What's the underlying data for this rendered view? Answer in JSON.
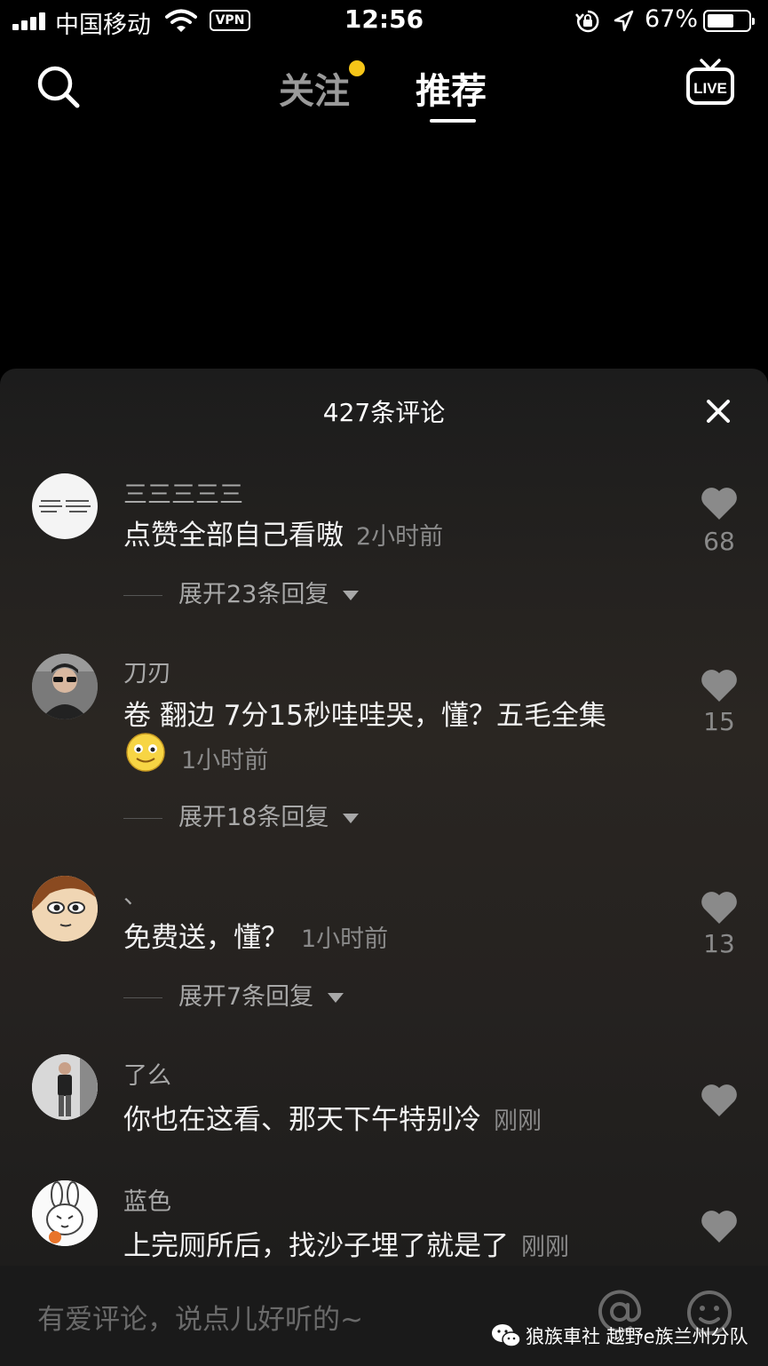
{
  "status_bar": {
    "carrier": "中国移动",
    "vpn": "VPN",
    "time": "12:56",
    "battery_pct": "67%",
    "battery_level": 0.67
  },
  "nav": {
    "tabs": [
      {
        "label": "关注",
        "active": false,
        "badge": true
      },
      {
        "label": "推荐",
        "active": true
      }
    ],
    "live_label": "LIVE",
    "icons": [
      "search-icon",
      "live-tv-icon"
    ]
  },
  "comments_panel": {
    "title": "427条评论",
    "comments": [
      {
        "username": "三三三三三",
        "text": "点赞全部自己看嗷",
        "time": "2小时前",
        "likes": "68",
        "replies": "展开23条回复"
      },
      {
        "username": "刀刃",
        "text": "卷 翻边 7分15秒哇哇哭，懂？五毛全集",
        "emoji": "smile-emoji",
        "time": "1小时前",
        "likes": "15",
        "replies": "展开18条回复"
      },
      {
        "username": "、",
        "text": "免费送，懂？",
        "time": "1小时前",
        "likes": "13",
        "replies": "展开7条回复"
      },
      {
        "username": "了么",
        "text": "你也在这看、那天下午特别冷",
        "time": "刚刚"
      },
      {
        "username": "蓝色",
        "text": "上完厕所后，找沙子埋了就是了",
        "time": "刚刚"
      }
    ]
  },
  "input_bar": {
    "placeholder": "有爱评论，说点儿好听的~",
    "icons": [
      "at-icon",
      "emoji-icon"
    ]
  },
  "watermark": {
    "text": "狼族車社 越野e族兰州分队"
  },
  "colors": {
    "accent_dot": "#f5c518",
    "background": "#000000",
    "sheet": "#2a2622"
  }
}
